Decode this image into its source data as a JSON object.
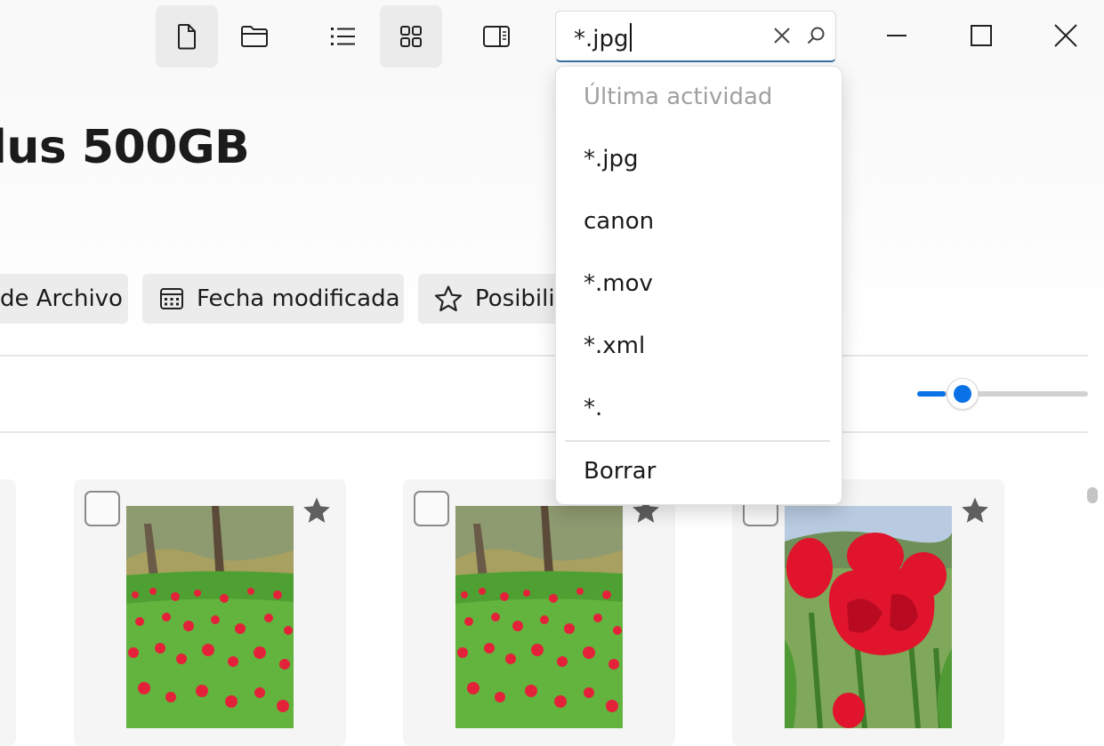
{
  "search": {
    "value": "*.jpg",
    "clear_icon": "close-icon",
    "search_icon": "search-icon"
  },
  "toolbar": {
    "buttons": [
      {
        "name": "file-icon",
        "active": true
      },
      {
        "name": "folder-icon",
        "active": false
      },
      {
        "name": "list-view-icon",
        "active": false
      },
      {
        "name": "grid-view-icon",
        "active": true
      },
      {
        "name": "details-pane-icon",
        "active": false
      }
    ]
  },
  "window_controls": [
    "minimize-icon",
    "maximize-icon",
    "close-icon"
  ],
  "header": {
    "title": "lus 500GB"
  },
  "filters": [
    {
      "label": "de Archivo",
      "icon": ""
    },
    {
      "label": "Fecha modificada",
      "icon": "calendar-icon"
    },
    {
      "label": "Posibilid",
      "icon": "star-outline-icon"
    }
  ],
  "zoom_slider": {
    "value_fraction": 0.27
  },
  "dropdown": {
    "header": "Última actividad",
    "items": [
      "*.jpg",
      "canon",
      "*.mov",
      "*.xml",
      "*."
    ],
    "clear_label": "Borrar"
  },
  "cards": [
    {
      "image": "tulip-field-trees"
    },
    {
      "image": "tulip-field-trees"
    },
    {
      "image": "red-tulips-closeup"
    }
  ],
  "colors": {
    "accent": "#0a72e6",
    "underline": "#3a6ea5"
  }
}
